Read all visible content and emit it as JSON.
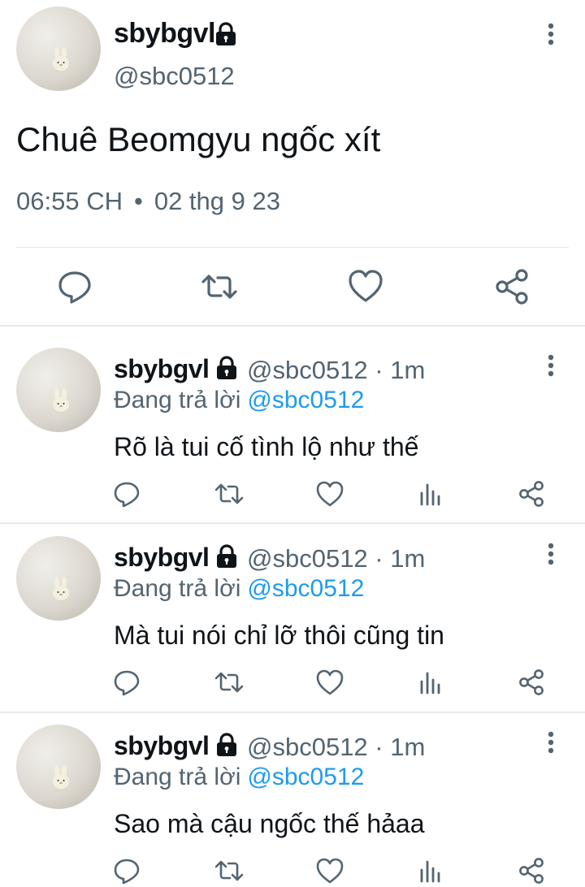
{
  "main_tweet": {
    "display_name": "sbybgvl",
    "handle": "@sbc0512",
    "text": "Chuê Beomgyu ngốc xít",
    "time": "06:55 CH",
    "separator": "•",
    "date": "02 thg 9 23"
  },
  "replies": [
    {
      "display_name": "sbybgvl",
      "handle_time": "@sbc0512 · 1m",
      "replying_label": "Đang trả lời",
      "replying_to": "@sbc0512",
      "text": "Rõ là tui cố tình lộ như thế"
    },
    {
      "display_name": "sbybgvl",
      "handle_time": "@sbc0512 · 1m",
      "replying_label": "Đang trả lời",
      "replying_to": "@sbc0512",
      "text": "Mà tui nói chỉ lỡ thôi cũng tin"
    },
    {
      "display_name": "sbybgvl",
      "handle_time": "@sbc0512 · 1m",
      "replying_label": "Đang trả lời",
      "replying_to": "@sbc0512",
      "text": "Sao mà cậu ngốc thế hảaa"
    }
  ],
  "icons": {
    "lock": "lock-icon",
    "more": "more-vertical-icon",
    "reply": "reply-icon",
    "retweet": "retweet-icon",
    "like": "heart-icon",
    "views": "analytics-icon",
    "share": "share-icon"
  },
  "colors": {
    "text": "#0f1419",
    "secondary": "#536471",
    "link": "#1d9bf0",
    "divider": "#e6e9eb"
  }
}
